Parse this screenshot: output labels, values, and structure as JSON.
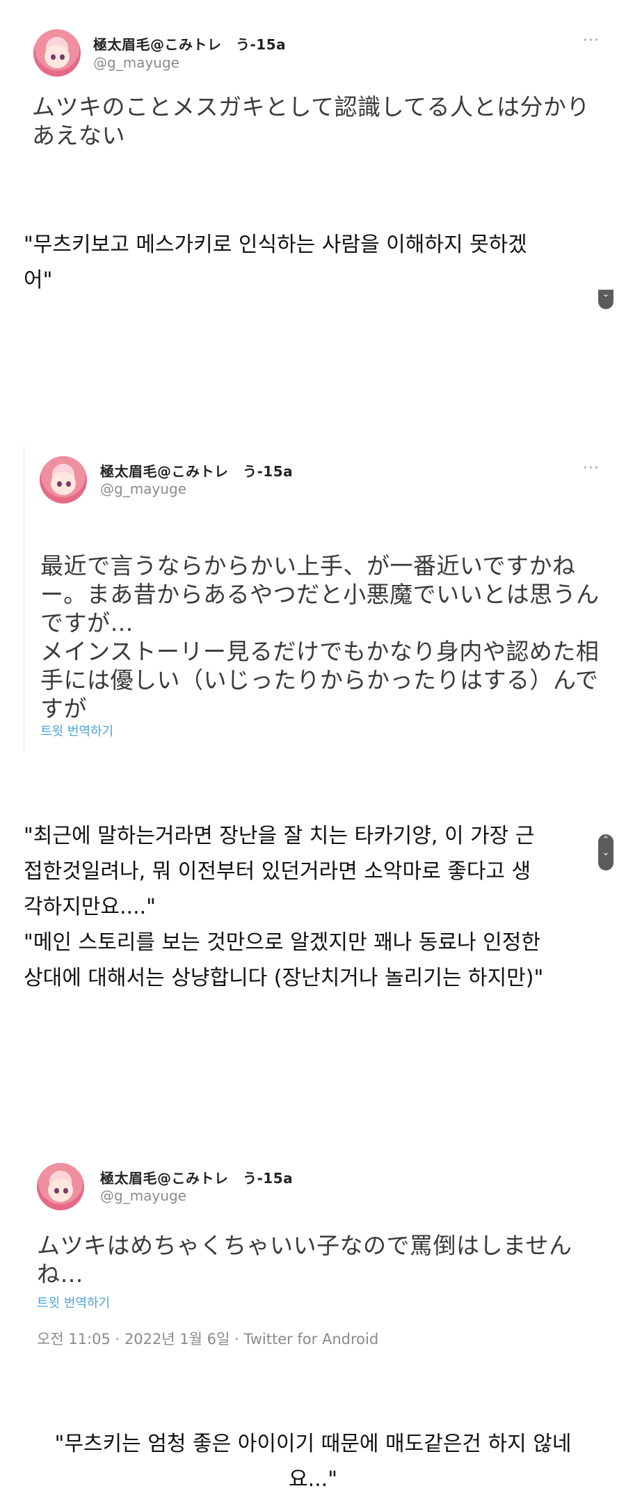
{
  "tweet1": {
    "display_name": "極太眉毛@こみトレ　う-15a",
    "handle": "@g_mayuge",
    "more": "···",
    "text_line1": "ムツキのことメスガキとして認識してる人とは分かり",
    "text_line2": "あえない"
  },
  "caption1": {
    "line1": "\"무츠키보고 메스가키로 인식하는 사람을 이해하지 못하겠",
    "line2": "어\""
  },
  "tweet2": {
    "display_name": "極太眉毛@こみトレ　う-15a",
    "handle": "@g_mayuge",
    "more": "···",
    "lines": [
      "最近で言うならからかい上手、が一番近いですかね",
      "ー。まあ昔からあるやつだと小悪魔でいいとは思うん",
      "ですが…",
      "メインストーリー見るだけでもかなり身内や認めた相",
      "手には優しい（いじったりからかったりはする）んで",
      "すが"
    ],
    "translate": "트윗 번역하기"
  },
  "caption2": {
    "lines": [
      "\"최근에 말하는거라면 장난을 잘 치는 타카기양, 이 가장 근",
      "접한것일려나, 뭐 이전부터 있던거라면 소악마로 좋다고 생",
      "각하지만요....\"",
      "\"메인 스토리를 보는 것만으로 알겠지만 꽤나 동료나 인정한",
      "상대에 대해서는 상냥합니다 (장난치거나 놀리기는 하지만)\""
    ]
  },
  "tweet3": {
    "display_name": "極太眉毛@こみトレ　う-15a",
    "handle": "@g_mayuge",
    "text_line1": "ムツキはめちゃくちゃいい子なので罵倒はしません",
    "text_line2": "ね…",
    "translate": "트윗 번역하기",
    "meta": "오전 11:05 · 2022년 1월 6일 · Twitter for Android"
  },
  "caption3": {
    "line1": "\"무츠키는 엄청 좋은 아이이기 때문에 매도같은건 하지 않네",
    "line2": "요...\""
  },
  "scroll": {
    "down": "⌄",
    "up": "⌃"
  }
}
